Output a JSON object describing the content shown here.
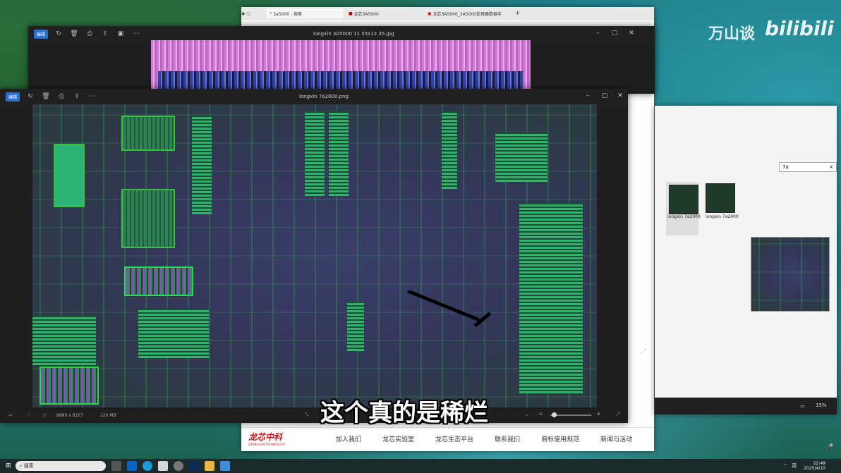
{
  "browser": {
    "tabs": [
      {
        "label": "3a5000 - 搜索"
      },
      {
        "label": "龙芯3A5000"
      },
      {
        "label": "龙芯3A5000_3A5000处理器数据手"
      }
    ],
    "footer_logo": "龙芯中科",
    "footer_logo_sub": "LOONGSON TECHNOLOGY",
    "footer_links": [
      "加入我们",
      "龙芯实验室",
      "龙芯生态平台",
      "联系我们",
      "商标使用规范",
      "新闻与活动"
    ]
  },
  "back_viewer": {
    "edit_label": "编辑",
    "title": "longxin 3A5000 11.55x12.35.jpg"
  },
  "front_viewer": {
    "edit_label": "编辑",
    "title": "longxin 7a2000.png",
    "status_dims": "8880 x 8167",
    "status_size": "120 MB"
  },
  "explorer": {
    "search_value": "7a",
    "files": [
      {
        "name": "longxin 7a2000"
      },
      {
        "name": "longxin 7a2000"
      }
    ],
    "zoom": "15%"
  },
  "watermark": {
    "author": "万山谈",
    "site": "bilibili"
  },
  "subtitle": "这个真的是稀烂",
  "taskbar": {
    "search_placeholder": "搜索",
    "time": "22:48",
    "date": "2025/4/10",
    "lang": "英"
  }
}
